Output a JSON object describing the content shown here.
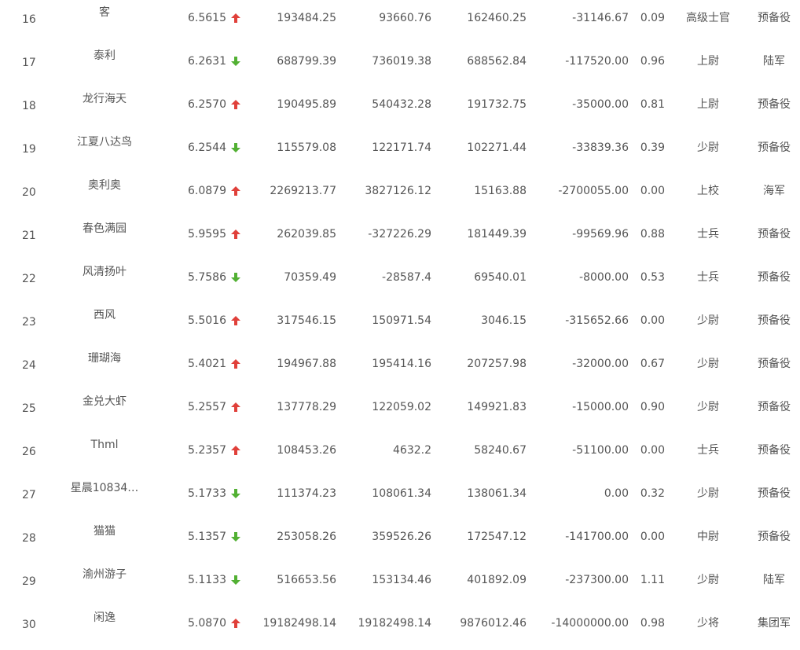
{
  "colors": {
    "up": "#e0403a",
    "down": "#52b033",
    "text": "#555555"
  },
  "icons": {
    "up": "arrow-up-icon",
    "down": "arrow-down-icon"
  },
  "rows": [
    {
      "rank": "16",
      "name": "客",
      "score": "6.5615",
      "trend": "up",
      "v1": "193484.25",
      "v2": "93660.76",
      "v3": "162460.25",
      "v4": "-31146.67",
      "ratio": "0.09",
      "title": "高级士官",
      "branch": "预备役"
    },
    {
      "rank": "17",
      "name": "泰利",
      "score": "6.2631",
      "trend": "down",
      "v1": "688799.39",
      "v2": "736019.38",
      "v3": "688562.84",
      "v4": "-117520.00",
      "ratio": "0.96",
      "title": "上尉",
      "branch": "陆军"
    },
    {
      "rank": "18",
      "name": "龙行海天",
      "score": "6.2570",
      "trend": "up",
      "v1": "190495.89",
      "v2": "540432.28",
      "v3": "191732.75",
      "v4": "-35000.00",
      "ratio": "0.81",
      "title": "上尉",
      "branch": "预备役"
    },
    {
      "rank": "19",
      "name": "江夏八达鸟",
      "score": "6.2544",
      "trend": "down",
      "v1": "115579.08",
      "v2": "122171.74",
      "v3": "102271.44",
      "v4": "-33839.36",
      "ratio": "0.39",
      "title": "少尉",
      "branch": "预备役"
    },
    {
      "rank": "20",
      "name": "奥利奥",
      "score": "6.0879",
      "trend": "up",
      "v1": "2269213.77",
      "v2": "3827126.12",
      "v3": "15163.88",
      "v4": "-2700055.00",
      "ratio": "0.00",
      "title": "上校",
      "branch": "海军"
    },
    {
      "rank": "21",
      "name": "春色满园",
      "score": "5.9595",
      "trend": "up",
      "v1": "262039.85",
      "v2": "-327226.29",
      "v3": "181449.39",
      "v4": "-99569.96",
      "ratio": "0.88",
      "title": "士兵",
      "branch": "预备役"
    },
    {
      "rank": "22",
      "name": "风清扬叶",
      "score": "5.7586",
      "trend": "down",
      "v1": "70359.49",
      "v2": "-28587.4",
      "v3": "69540.01",
      "v4": "-8000.00",
      "ratio": "0.53",
      "title": "士兵",
      "branch": "预备役"
    },
    {
      "rank": "23",
      "name": "西风",
      "score": "5.5016",
      "trend": "up",
      "v1": "317546.15",
      "v2": "150971.54",
      "v3": "3046.15",
      "v4": "-315652.66",
      "ratio": "0.00",
      "title": "少尉",
      "branch": "预备役"
    },
    {
      "rank": "24",
      "name": "珊瑚海",
      "score": "5.4021",
      "trend": "up",
      "v1": "194967.88",
      "v2": "195414.16",
      "v3": "207257.98",
      "v4": "-32000.00",
      "ratio": "0.67",
      "title": "少尉",
      "branch": "预备役"
    },
    {
      "rank": "25",
      "name": "金兑大虾",
      "score": "5.2557",
      "trend": "up",
      "v1": "137778.29",
      "v2": "122059.02",
      "v3": "149921.83",
      "v4": "-15000.00",
      "ratio": "0.90",
      "title": "少尉",
      "branch": "预备役"
    },
    {
      "rank": "26",
      "name": "Thml",
      "score": "5.2357",
      "trend": "up",
      "v1": "108453.26",
      "v2": "4632.2",
      "v3": "58240.67",
      "v4": "-51100.00",
      "ratio": "0.00",
      "title": "士兵",
      "branch": "预备役"
    },
    {
      "rank": "27",
      "name": "星晨10834…",
      "score": "5.1733",
      "trend": "down",
      "v1": "111374.23",
      "v2": "108061.34",
      "v3": "138061.34",
      "v4": "0.00",
      "ratio": "0.32",
      "title": "少尉",
      "branch": "预备役"
    },
    {
      "rank": "28",
      "name": "猫猫",
      "score": "5.1357",
      "trend": "down",
      "v1": "253058.26",
      "v2": "359526.26",
      "v3": "172547.12",
      "v4": "-141700.00",
      "ratio": "0.00",
      "title": "中尉",
      "branch": "预备役"
    },
    {
      "rank": "29",
      "name": "渝州游子",
      "score": "5.1133",
      "trend": "down",
      "v1": "516653.56",
      "v2": "153134.46",
      "v3": "401892.09",
      "v4": "-237300.00",
      "ratio": "1.11",
      "title": "少尉",
      "branch": "陆军"
    },
    {
      "rank": "30",
      "name": "闲逸",
      "score": "5.0870",
      "trend": "up",
      "v1": "19182498.14",
      "v2": "19182498.14",
      "v3": "9876012.46",
      "v4": "-14000000.00",
      "ratio": "0.98",
      "title": "少将",
      "branch": "集团军"
    }
  ]
}
